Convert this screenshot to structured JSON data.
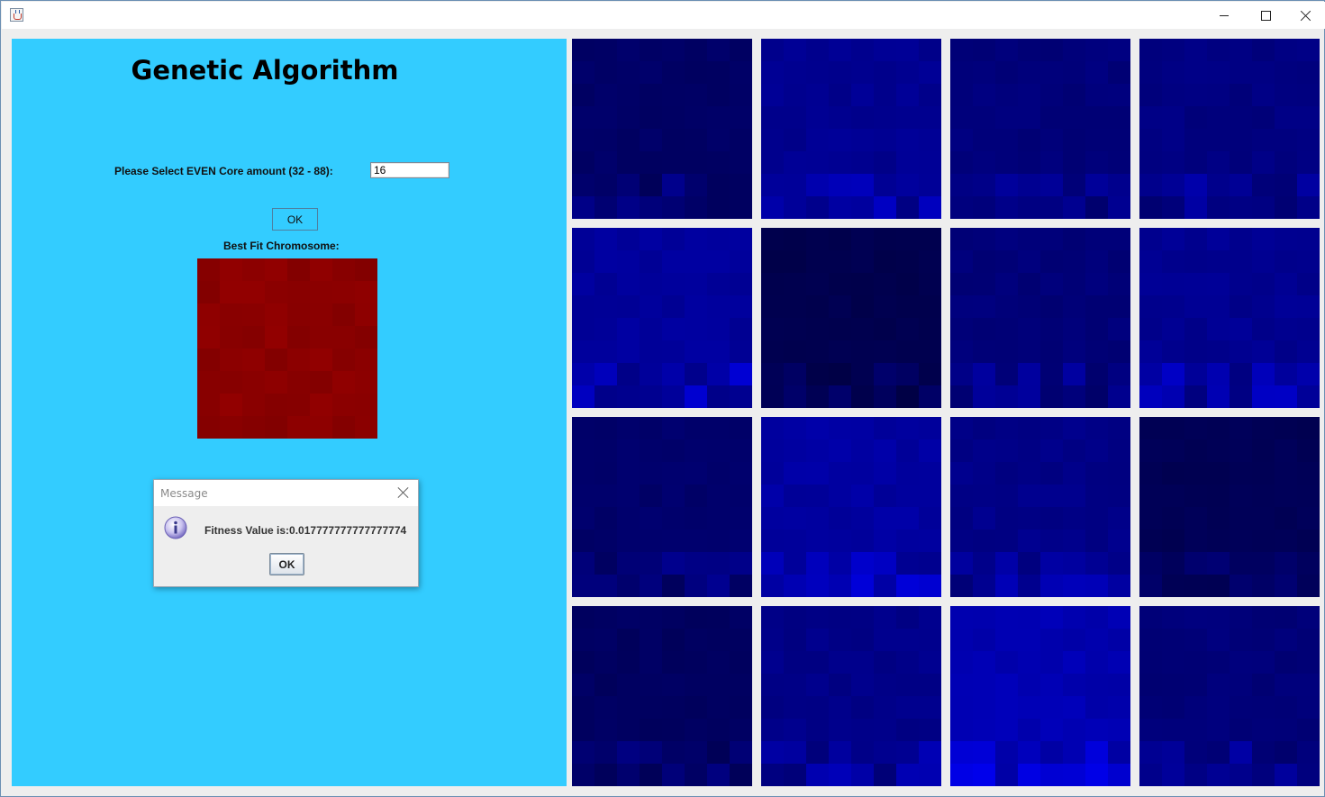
{
  "window": {
    "app_icon": "java-cup-icon",
    "controls": [
      "minimize-icon",
      "maximize-icon",
      "close-icon"
    ]
  },
  "main": {
    "title": "Genetic Algorithm",
    "core_prompt": "Please Select EVEN Core amount (32 - 88):",
    "core_value": "16",
    "ok_label": "OK",
    "best_fit_label": "Best Fit Chromosome:",
    "panel_color": "#33ccff",
    "best_fit_color": "#8a0000"
  },
  "dialog": {
    "title": "Message",
    "icon": "info-icon",
    "message": "Fitness Value is:0.017777777777777774",
    "ok_label": "OK"
  },
  "population": {
    "count": 16,
    "tile_colors": [
      "#000066",
      "#000090",
      "#00007a",
      "#000080",
      "#00009a",
      "#00004e",
      "#000078",
      "#000090",
      "#00006a",
      "#0000a0",
      "#000088",
      "#000055",
      "#000060",
      "#000088",
      "#0000b0",
      "#000078"
    ]
  }
}
